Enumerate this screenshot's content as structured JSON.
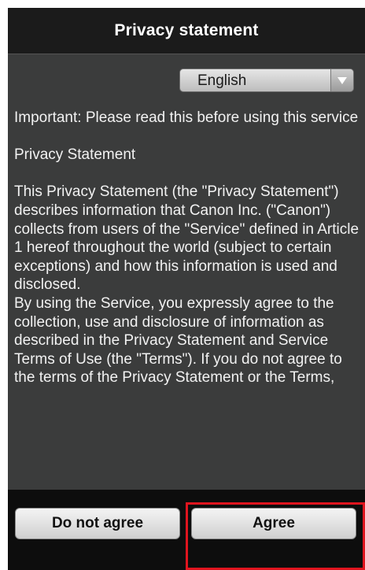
{
  "header": {
    "title": "Privacy statement"
  },
  "language_select": {
    "selected": "English",
    "icon": "dropdown-arrow-icon"
  },
  "content": {
    "paragraphs": [
      "Important: Please read this before using this service",
      "Privacy Statement",
      "This Privacy Statement (the \"Privacy Statement\") describes information that Canon Inc. (\"Canon\") collects from users of the \"Service\" defined in Article 1 hereof throughout the world (subject to certain exceptions) and how this information is used and disclosed.",
      "By using the Service, you expressly agree to the collection, use and disclosure of information as described in the Privacy Statement and Service Terms of Use (the \"Terms\"). If you do not agree to the terms of the Privacy Statement or the Terms,"
    ]
  },
  "footer": {
    "disagree_label": "Do not agree",
    "agree_label": "Agree"
  },
  "colors": {
    "highlight": "#e0141e",
    "background": "#3b3c3c",
    "header": "#1b1b1b"
  }
}
